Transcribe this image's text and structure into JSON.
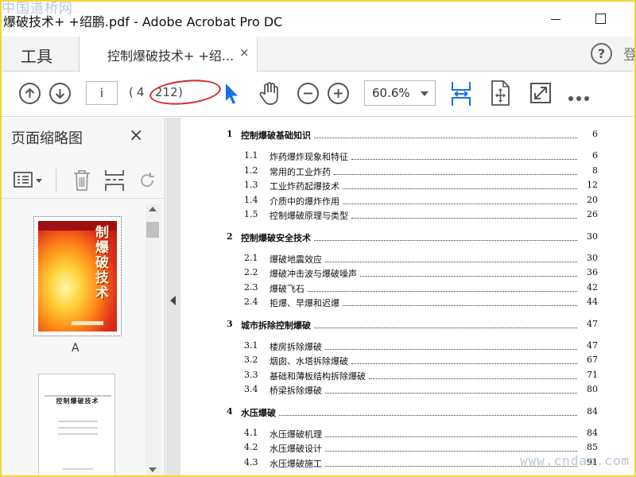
{
  "watermarks": {
    "top": "中国道桥网",
    "bottom": "www.cndao.com"
  },
  "window": {
    "title": "爆破技术+ +绍鹏.pdf - Adobe Acrobat Pro DC"
  },
  "tabs": {
    "tools": "工具",
    "document": "控制爆破技术+ +绍...",
    "close": "×",
    "help": "?",
    "overflow": "登"
  },
  "toolbar": {
    "icons": [
      "prev-page-icon",
      "next-page-icon",
      "select-cursor-icon",
      "hand-tool-icon",
      "zoom-out-icon",
      "zoom-in-icon",
      "fit-width-icon",
      "rotate-view-icon",
      "full-screen-icon",
      "more-tools-icon"
    ],
    "page_value": "i",
    "paren_open": "(",
    "page_label": "4",
    "page_total": "212",
    "paren_close": ")",
    "zoom_value": "60.6%",
    "annotation_color": "#d42a2a",
    "accent_color": "#1473e6"
  },
  "side_panel": {
    "title": "页面缩略图",
    "close": "×",
    "thumbnails": [
      {
        "label": "A",
        "cover_title": "控制爆破技术"
      },
      {
        "label": "",
        "page_title": "控制爆破技术"
      }
    ]
  },
  "toc": [
    {
      "level": "chapter",
      "num": "1",
      "title": "控制爆破基础知识",
      "page": "6"
    },
    {
      "level": "section",
      "num": "1.1",
      "title": "炸药爆炸现象和特征",
      "page": "6"
    },
    {
      "level": "section",
      "num": "1.2",
      "title": "常用的工业炸药",
      "page": "8"
    },
    {
      "level": "section",
      "num": "1.3",
      "title": "工业炸药起爆技术",
      "page": "12"
    },
    {
      "level": "section",
      "num": "1.4",
      "title": "介质中的爆炸作用",
      "page": "20"
    },
    {
      "level": "section",
      "num": "1.5",
      "title": "控制爆破原理与类型",
      "page": "26"
    },
    {
      "level": "chapter",
      "num": "2",
      "title": "控制爆破安全技术",
      "page": "30"
    },
    {
      "level": "section",
      "num": "2.1",
      "title": "爆破地震效应",
      "page": "30"
    },
    {
      "level": "section",
      "num": "2.2",
      "title": "爆破冲击波与爆破噪声",
      "page": "36"
    },
    {
      "level": "section",
      "num": "2.3",
      "title": "爆破飞石",
      "page": "42"
    },
    {
      "level": "section",
      "num": "2.4",
      "title": "拒爆、早爆和迟爆",
      "page": "44"
    },
    {
      "level": "chapter",
      "num": "3",
      "title": "城市拆除控制爆破",
      "page": "47"
    },
    {
      "level": "section",
      "num": "3.1",
      "title": "楼房拆除爆破",
      "page": "47"
    },
    {
      "level": "section",
      "num": "3.2",
      "title": "烟囱、水塔拆除爆破",
      "page": "67"
    },
    {
      "level": "section",
      "num": "3.3",
      "title": "基础和薄板结构拆除爆破",
      "page": "71"
    },
    {
      "level": "section",
      "num": "3.4",
      "title": "桥梁拆除爆破",
      "page": "80"
    },
    {
      "level": "chapter",
      "num": "4",
      "title": "水压爆破",
      "page": "84"
    },
    {
      "level": "section",
      "num": "4.1",
      "title": "水压爆破机理",
      "page": "84"
    },
    {
      "level": "section",
      "num": "4.2",
      "title": "水压爆破设计",
      "page": "85"
    },
    {
      "level": "section",
      "num": "4.3",
      "title": "水压爆破施工",
      "page": "91"
    }
  ]
}
